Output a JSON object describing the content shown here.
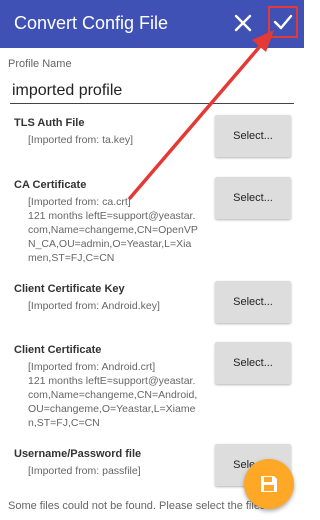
{
  "appbar": {
    "title": "Convert Config File",
    "close_icon": "close-icon",
    "confirm_icon": "check-icon",
    "color": "#3F51B5"
  },
  "profile": {
    "label": "Profile Name",
    "value": "imported profile"
  },
  "sections": [
    {
      "title": "TLS Auth File",
      "imported": "[Imported from: ta.key]",
      "detail": "",
      "button": "Select..."
    },
    {
      "title": "CA Certificate",
      "imported": "[Imported from: ca.crt]",
      "detail": "121 months leftE=support@yeastar.com,Name=changeme,CN=OpenVPN_CA,OU=admin,O=Yeastar,L=Xiamen,ST=FJ,C=CN",
      "button": "Select..."
    },
    {
      "title": "Client Certificate Key",
      "imported": "[Imported from: Android.key]",
      "detail": "",
      "button": "Select..."
    },
    {
      "title": "Client Certificate",
      "imported": "[Imported from: Android.crt]",
      "detail": "121 months leftE=support@yeastar.com,Name=changeme,CN=Android,OU=changeme,O=Yeastar,L=Xiamen,ST=FJ,C=CN",
      "button": "Select..."
    },
    {
      "title": "Username/Password file",
      "imported": "[Imported from: passfile]",
      "detail": "",
      "button": "Select..."
    }
  ],
  "footer_note": "Some files could not be found. Please select the files",
  "fab": {
    "icon": "save-icon",
    "color": "#FFA726"
  },
  "annotation": {
    "highlight_color": "#e53935"
  }
}
